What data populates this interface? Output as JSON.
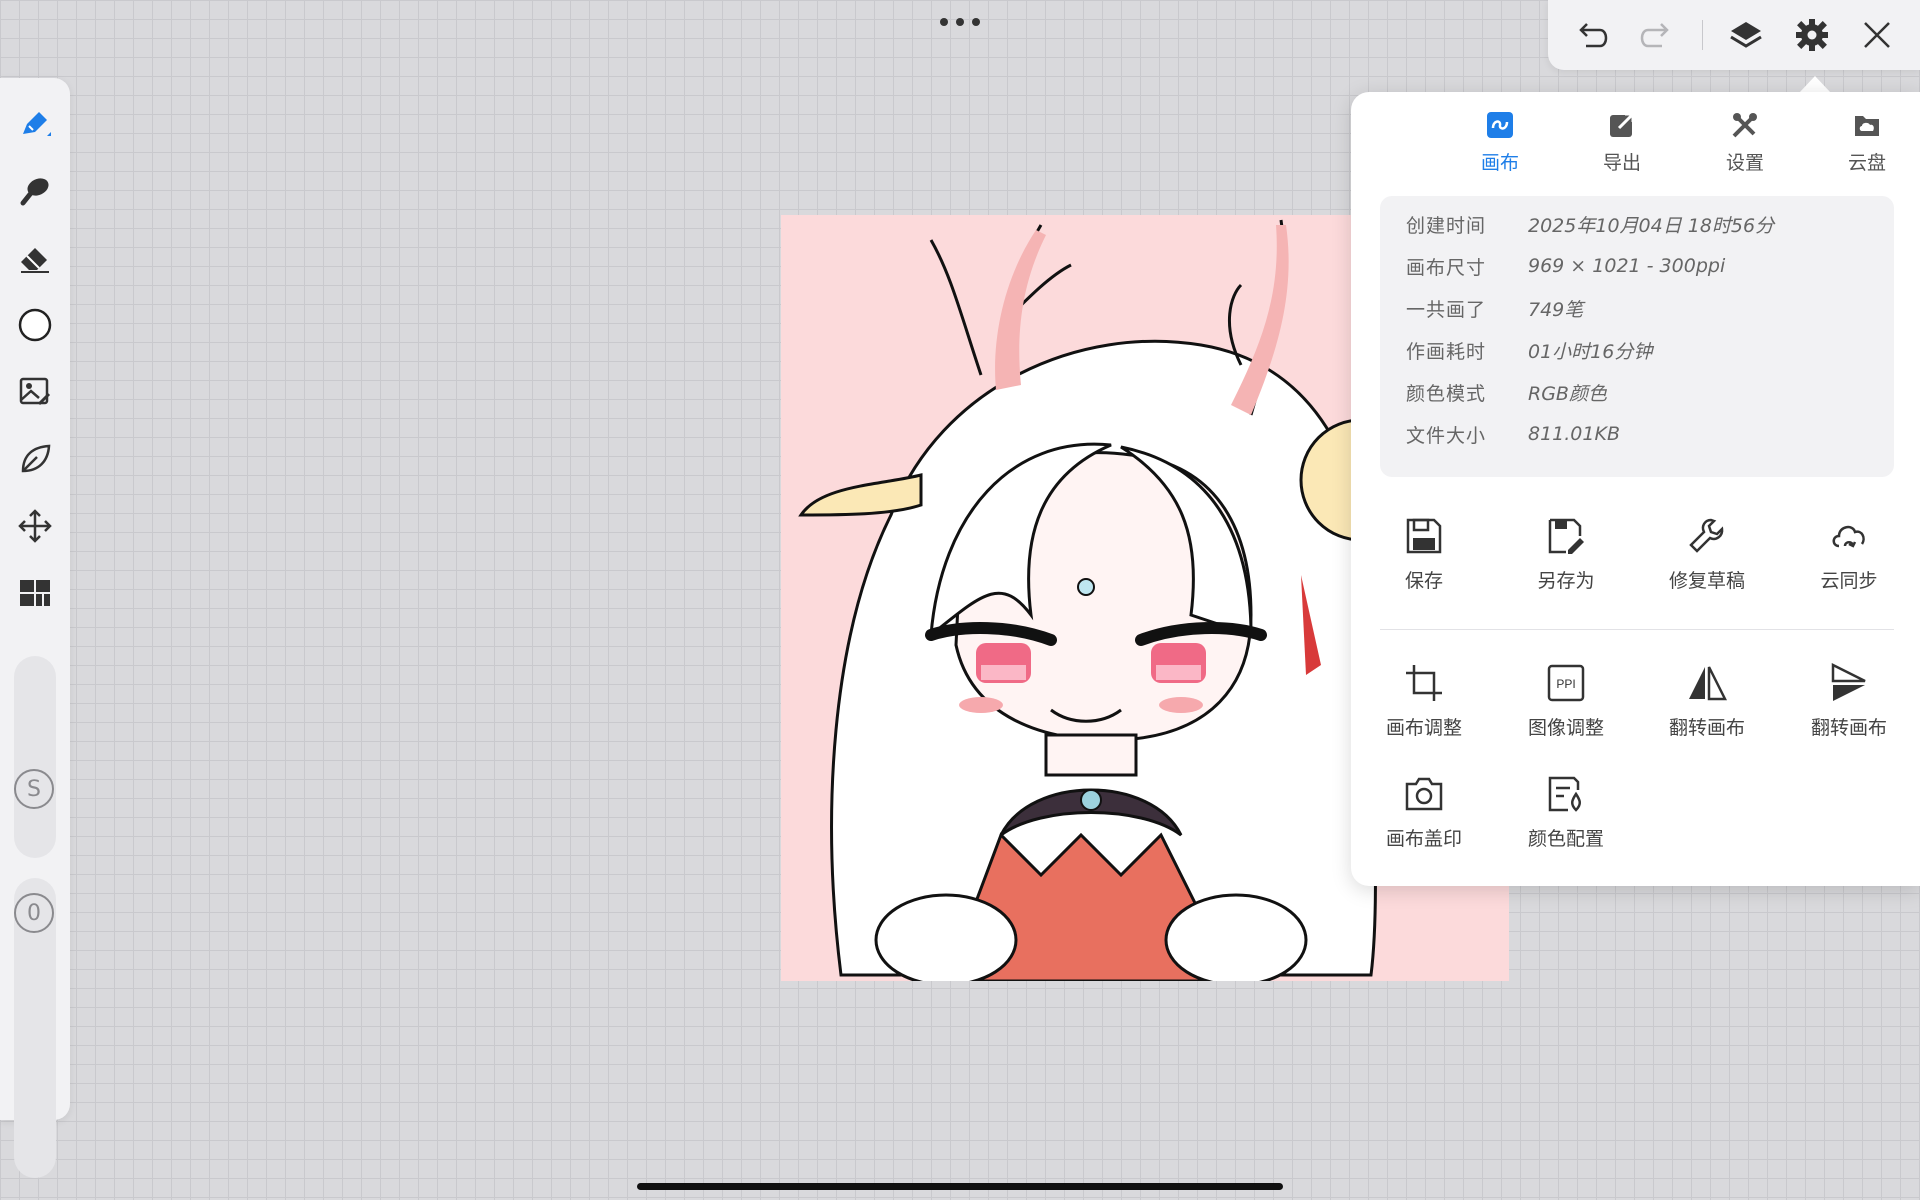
{
  "panel": {
    "tabs": [
      {
        "label": "画布",
        "icon": "canvas-icon",
        "active": true
      },
      {
        "label": "导出",
        "icon": "export-icon",
        "active": false
      },
      {
        "label": "设置",
        "icon": "tools-icon",
        "active": false
      },
      {
        "label": "云盘",
        "icon": "cloud-drive-icon",
        "active": false
      }
    ],
    "info": [
      {
        "key": "创建时间",
        "value": "2025年10月04日 18时56分"
      },
      {
        "key": "画布尺寸",
        "value": "969 × 1021 - 300ppi"
      },
      {
        "key": "一共画了",
        "value": "749笔"
      },
      {
        "key": "作画耗时",
        "value": "01小时16分钟"
      },
      {
        "key": "颜色模式",
        "value": "RGB颜色"
      },
      {
        "key": "文件大小",
        "value": "811.01KB"
      }
    ],
    "actions_row1": [
      {
        "label": "保存",
        "icon": "save-icon"
      },
      {
        "label": "另存为",
        "icon": "save-as-icon"
      },
      {
        "label": "修复草稿",
        "icon": "wrench-icon"
      },
      {
        "label": "云同步",
        "icon": "cloud-sync-icon"
      }
    ],
    "actions_row2": [
      {
        "label": "画布调整",
        "icon": "crop-icon"
      },
      {
        "label": "图像调整",
        "icon": "ppi-icon",
        "badge": "PPI"
      },
      {
        "label": "翻转画布",
        "icon": "flip-horizontal-icon"
      },
      {
        "label": "翻转画布",
        "icon": "flip-vertical-icon"
      }
    ],
    "actions_row3": [
      {
        "label": "画布盖印",
        "icon": "camera-icon"
      },
      {
        "label": "颜色配置",
        "icon": "color-profile-icon"
      }
    ]
  },
  "left_toolbar": {
    "tools": [
      "brush-icon",
      "smudge-icon",
      "eraser-icon",
      "color-circle-icon",
      "image-icon",
      "leaf-icon",
      "move-icon",
      "grid-icon"
    ],
    "size_label": "S",
    "opacity_label": "0"
  },
  "top_bar": {
    "buttons": [
      "undo-icon",
      "redo-icon",
      "layers-icon",
      "settings-icon",
      "close-icon"
    ]
  },
  "colors": {
    "accent": "#1e7ee8",
    "canvas_bg": "#fcdadb",
    "panel_bg": "#ffffff"
  }
}
